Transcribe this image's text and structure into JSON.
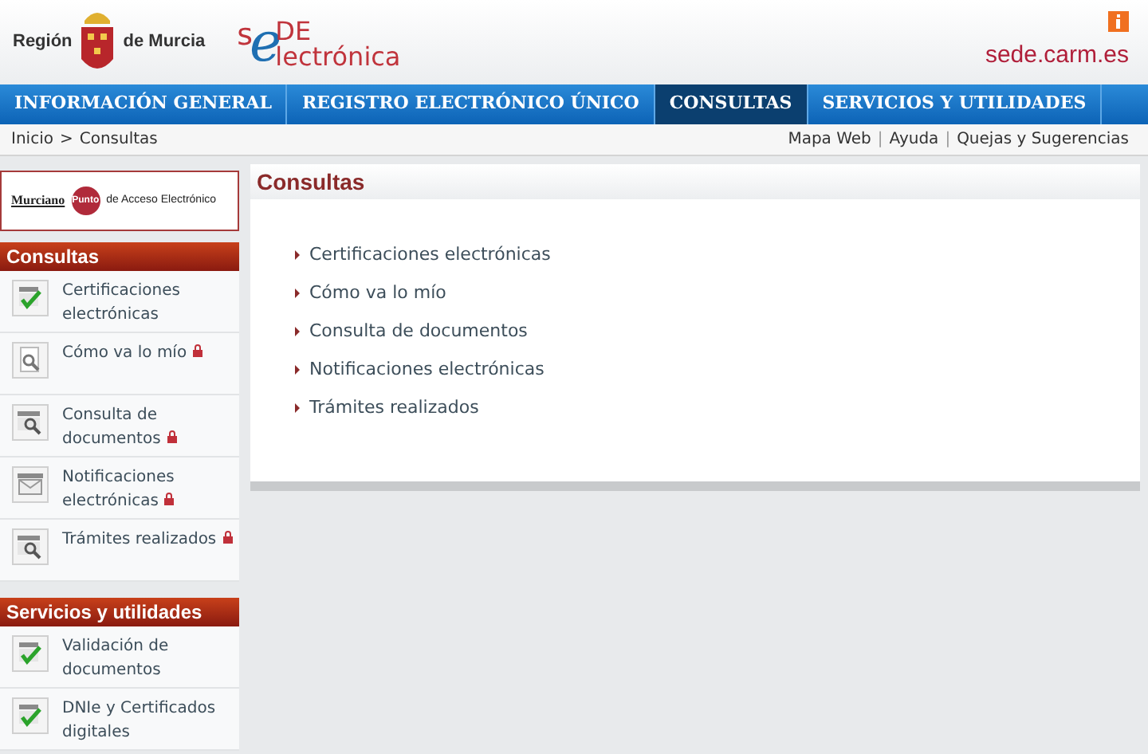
{
  "header": {
    "region_logo": {
      "left": "Región",
      "right": "de Murcia"
    },
    "sede_logo": {
      "s": "s",
      "e": "e",
      "de": "DE",
      "rest": "lectrónica"
    },
    "site": "sede.carm.es"
  },
  "nav": [
    {
      "label": "INFORMACIÓN GENERAL",
      "selected": false
    },
    {
      "label": "REGISTRO ELECTRÓNICO ÚNICO",
      "selected": false
    },
    {
      "label": "CONSULTAS",
      "selected": true
    },
    {
      "label": "SERVICIOS Y UTILIDADES",
      "selected": false
    }
  ],
  "breadcrumb": {
    "items": [
      "Inicio",
      "Consultas"
    ],
    "separator": ">"
  },
  "top_links": {
    "items": [
      "Mapa Web",
      "Ayuda",
      "Quejas y Sugerencias"
    ],
    "separator": "|"
  },
  "sidebar": {
    "banner": {
      "left": "Murciano",
      "badge": "Punto",
      "right": "de Acceso Electrónico"
    },
    "sections": [
      {
        "title": "Consultas",
        "items": [
          {
            "label": "Certificaciones electrónicas",
            "kind": "check",
            "locked": false
          },
          {
            "label": "Cómo va lo mío",
            "kind": "search",
            "locked": true
          },
          {
            "label": "Consulta de documentos",
            "kind": "docsearch",
            "locked": true
          },
          {
            "label": "Notificaciones electrónicas",
            "kind": "mail",
            "locked": true
          },
          {
            "label": "Trámites realizados",
            "kind": "docsearch",
            "locked": true
          }
        ]
      },
      {
        "title": "Servicios y utilidades",
        "items": [
          {
            "label": "Validación de documentos",
            "kind": "check",
            "locked": false
          },
          {
            "label": "DNIe y Certificados digitales",
            "kind": "check",
            "locked": false
          }
        ]
      }
    ]
  },
  "main": {
    "title": "Consultas",
    "links": [
      "Certificaciones electrónicas",
      "Cómo va lo mío",
      "Consulta de documentos",
      "Notificaciones electrónicas",
      "Trámites realizados"
    ]
  }
}
